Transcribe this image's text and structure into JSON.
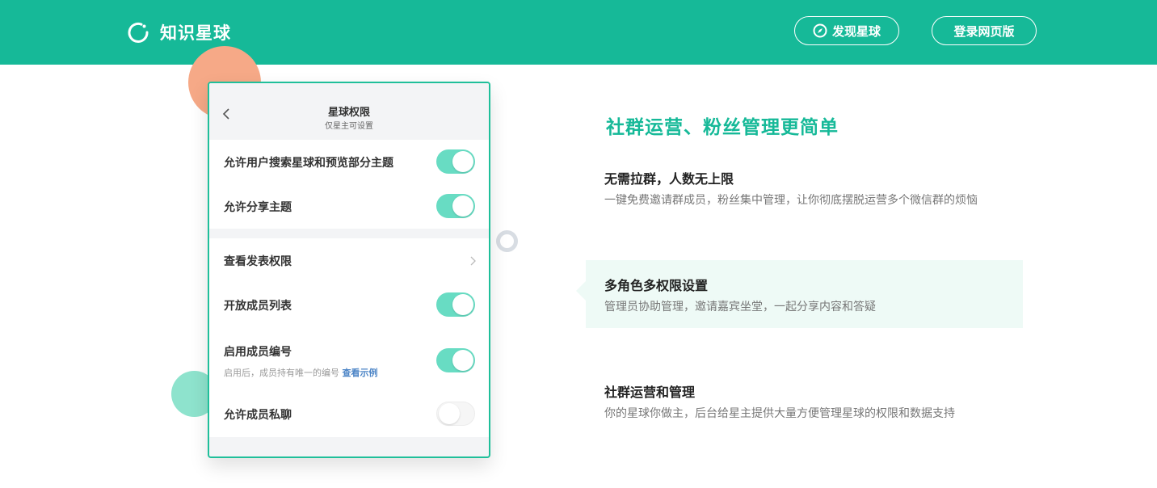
{
  "header": {
    "brand": "知识星球",
    "discover_label": "发现星球",
    "login_label": "登录网页版",
    "bg_color": "#16b998"
  },
  "phone": {
    "title": "星球权限",
    "subtitle": "仅星主可设置",
    "settings": [
      {
        "label": "允许用户搜索星球和预览部分主题",
        "toggle": true
      },
      {
        "label": "允许分享主题",
        "toggle": true
      },
      {
        "label": "查看发表权限",
        "chevron": true
      },
      {
        "label": "开放成员列表",
        "toggle": true
      },
      {
        "label": "启用成员编号",
        "sub": "启用后，成员持有唯一的编号",
        "link": "查看示例",
        "toggle": true
      },
      {
        "label": "允许成员私聊",
        "toggle": false
      }
    ]
  },
  "content": {
    "headline": "社群运营、粉丝管理更简单",
    "features": [
      {
        "title": "无需拉群，人数无上限",
        "desc": "一键免费邀请群成员，粉丝集中管理，让你彻底摆脱运营多个微信群的烦恼",
        "active": false
      },
      {
        "title": "多角色多权限设置",
        "desc": "管理员协助管理，邀请嘉宾坐堂，一起分享内容和答疑",
        "active": true
      },
      {
        "title": "社群运营和管理",
        "desc": "你的星球你做主，后台给星主提供大量方便管理星球的权限和数据支持",
        "active": false
      }
    ]
  }
}
